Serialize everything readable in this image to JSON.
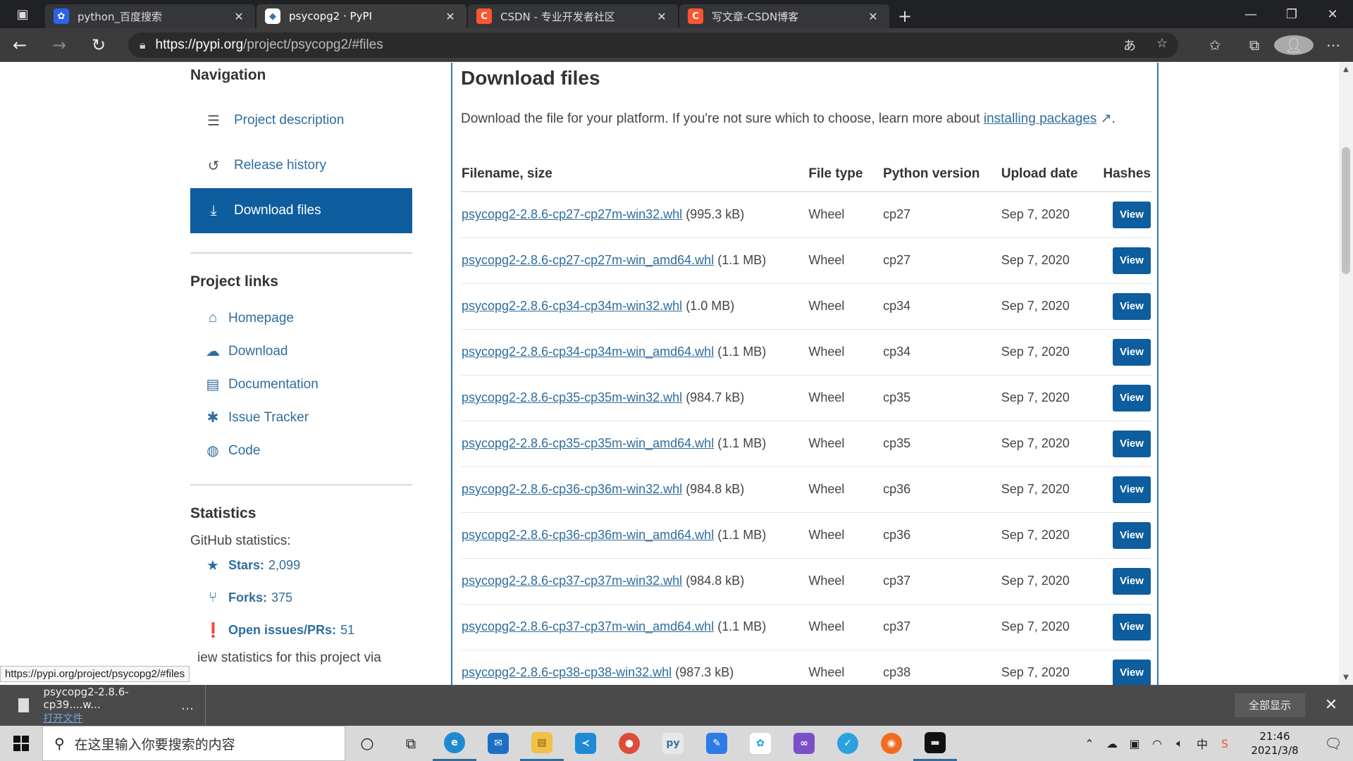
{
  "browser": {
    "tabs": [
      {
        "title": "python_百度搜索",
        "favicon": "baidu-paw-icon",
        "active": false
      },
      {
        "title": "psycopg2 · PyPI",
        "favicon": "pypi-cube-icon",
        "active": true
      },
      {
        "title": "CSDN - 专业开发者社区",
        "favicon": "csdn-c-icon",
        "active": false
      },
      {
        "title": "写文章-CSDN博客",
        "favicon": "csdn-c-icon",
        "active": false
      }
    ],
    "url_host": "https://pypi.org",
    "url_path": "/project/psycopg2/#files",
    "status_url": "https://pypi.org/project/psycopg2/#files"
  },
  "sidebar": {
    "navigation_heading": "Navigation",
    "nav": [
      {
        "label": "Project description",
        "icon": "align-left-icon",
        "active": false
      },
      {
        "label": "Release history",
        "icon": "history-icon",
        "active": false
      },
      {
        "label": "Download files",
        "icon": "download-icon",
        "active": true
      }
    ],
    "links_heading": "Project links",
    "links": [
      {
        "label": "Homepage",
        "icon": "home-icon"
      },
      {
        "label": "Download",
        "icon": "cloud-download-icon"
      },
      {
        "label": "Documentation",
        "icon": "book-icon"
      },
      {
        "label": "Issue Tracker",
        "icon": "bug-icon"
      },
      {
        "label": "Code",
        "icon": "github-icon"
      }
    ],
    "stats_heading": "Statistics",
    "github_label": "GitHub statistics:",
    "stats": [
      {
        "label": "Stars:",
        "value": "2,099",
        "icon": "star-icon"
      },
      {
        "label": "Forks:",
        "value": "375",
        "icon": "fork-icon"
      },
      {
        "label": "Open issues/PRs:",
        "value": "51",
        "icon": "alert-icon"
      }
    ],
    "stats_note": "iew statistics for this project via"
  },
  "main": {
    "title": "Download files",
    "intro_text": "Download the file for your platform. If you're not sure which to choose, learn more about ",
    "intro_link": "installing packages",
    "intro_end": ".",
    "columns": [
      "Filename, size",
      "File type",
      "Python version",
      "Upload date",
      "Hashes"
    ],
    "view_label": "View",
    "rows": [
      {
        "file": "psycopg2-2.8.6-cp27-cp27m-win32.whl",
        "size": "(995.3 kB)",
        "type": "Wheel",
        "python": "cp27",
        "date": "Sep 7, 2020"
      },
      {
        "file": "psycopg2-2.8.6-cp27-cp27m-win_amd64.whl",
        "size": "(1.1 MB)",
        "type": "Wheel",
        "python": "cp27",
        "date": "Sep 7, 2020"
      },
      {
        "file": "psycopg2-2.8.6-cp34-cp34m-win32.whl",
        "size": "(1.0 MB)",
        "type": "Wheel",
        "python": "cp34",
        "date": "Sep 7, 2020"
      },
      {
        "file": "psycopg2-2.8.6-cp34-cp34m-win_amd64.whl",
        "size": "(1.1 MB)",
        "type": "Wheel",
        "python": "cp34",
        "date": "Sep 7, 2020"
      },
      {
        "file": "psycopg2-2.8.6-cp35-cp35m-win32.whl",
        "size": "(984.7 kB)",
        "type": "Wheel",
        "python": "cp35",
        "date": "Sep 7, 2020"
      },
      {
        "file": "psycopg2-2.8.6-cp35-cp35m-win_amd64.whl",
        "size": "(1.1 MB)",
        "type": "Wheel",
        "python": "cp35",
        "date": "Sep 7, 2020"
      },
      {
        "file": "psycopg2-2.8.6-cp36-cp36m-win32.whl",
        "size": "(984.8 kB)",
        "type": "Wheel",
        "python": "cp36",
        "date": "Sep 7, 2020"
      },
      {
        "file": "psycopg2-2.8.6-cp36-cp36m-win_amd64.whl",
        "size": "(1.1 MB)",
        "type": "Wheel",
        "python": "cp36",
        "date": "Sep 7, 2020"
      },
      {
        "file": "psycopg2-2.8.6-cp37-cp37m-win32.whl",
        "size": "(984.8 kB)",
        "type": "Wheel",
        "python": "cp37",
        "date": "Sep 7, 2020"
      },
      {
        "file": "psycopg2-2.8.6-cp37-cp37m-win_amd64.whl",
        "size": "(1.1 MB)",
        "type": "Wheel",
        "python": "cp37",
        "date": "Sep 7, 2020"
      },
      {
        "file": "psycopg2-2.8.6-cp38-cp38-win32.whl",
        "size": "(987.3 kB)",
        "type": "Wheel",
        "python": "cp38",
        "date": "Sep 7, 2020"
      }
    ]
  },
  "download_bar": {
    "file": "psycopg2-2.8.6-cp39....w...",
    "open_label": "打开文件",
    "show_all": "全部显示"
  },
  "taskbar": {
    "search_placeholder": "在这里输入你要搜索的内容",
    "time": "21:46",
    "date": "2021/3/8",
    "ime": "中"
  },
  "colors": {
    "pypi_blue": "#0e5d9e",
    "link_blue": "#2f6d9e",
    "main_border": "#2e78b9"
  }
}
